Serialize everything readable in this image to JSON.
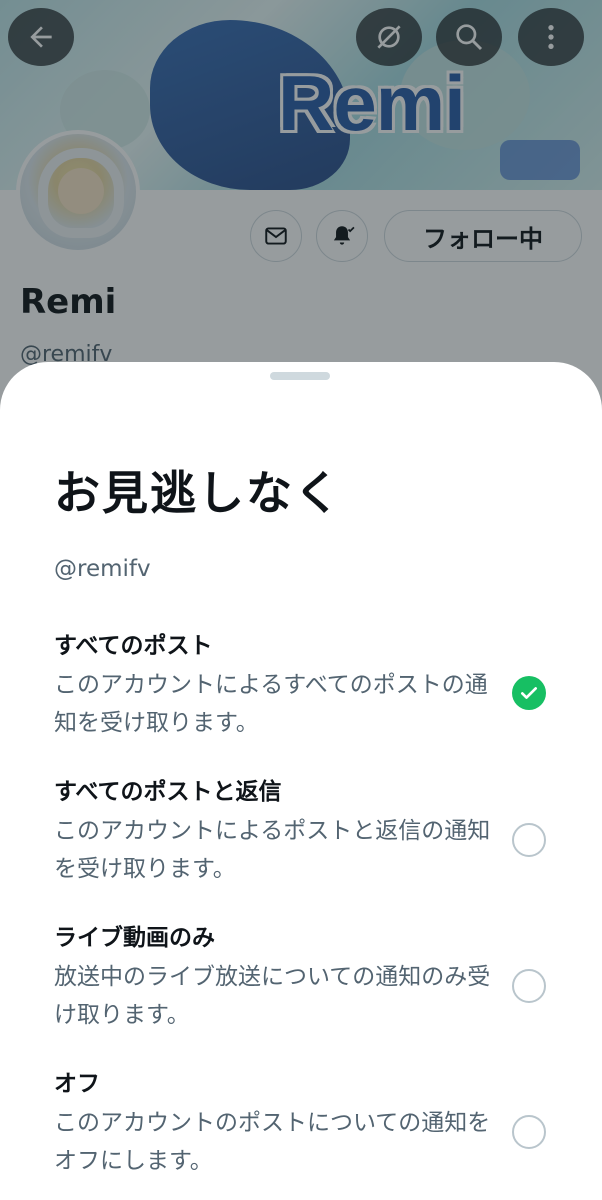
{
  "profile": {
    "banner_title": "Remi",
    "display_name": "Remi",
    "handle": "@remifv",
    "follow_button_label": "フォロー中"
  },
  "sheet": {
    "title": "お見逃しなく",
    "handle": "@remifv",
    "options": [
      {
        "title": "すべてのポスト",
        "description": "このアカウントによるすべてのポストの通知を受け取ります。",
        "selected": true
      },
      {
        "title": "すべてのポストと返信",
        "description": "このアカウントによるポストと返信の通知を受け取ります。",
        "selected": false
      },
      {
        "title": "ライブ動画のみ",
        "description": "放送中のライブ放送についての通知のみ受け取ります。",
        "selected": false
      },
      {
        "title": "オフ",
        "description": "このアカウントのポストについての通知をオフにします。",
        "selected": false
      }
    ]
  },
  "colors": {
    "accent_check": "#17bf63",
    "text_primary": "#0f1419",
    "text_secondary": "#536471"
  }
}
